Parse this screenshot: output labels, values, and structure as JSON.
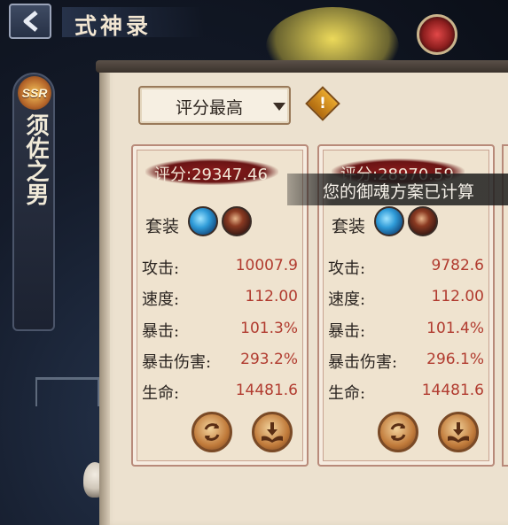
{
  "header": {
    "title": "式神录"
  },
  "shikigami": {
    "rarity": "SSR",
    "name": "须佐之男"
  },
  "sort": {
    "selected": "评分最高"
  },
  "toast": {
    "message": "您的御魂方案已计算"
  },
  "cards": [
    {
      "score": "评分:29347.46",
      "set_label": "套装",
      "stats": [
        {
          "label": "攻击:",
          "value": "10007.9"
        },
        {
          "label": "速度:",
          "value": "112.00"
        },
        {
          "label": "暴击:",
          "value": "101.3%"
        },
        {
          "label": "暴击伤害:",
          "value": "293.2%"
        },
        {
          "label": "生命:",
          "value": "14481.6"
        }
      ]
    },
    {
      "score": "评分:28970.59",
      "set_label": "套装",
      "stats": [
        {
          "label": "攻击:",
          "value": "9782.6"
        },
        {
          "label": "速度:",
          "value": "112.00"
        },
        {
          "label": "暴击:",
          "value": "101.4%"
        },
        {
          "label": "暴击伤害:",
          "value": "296.1%"
        },
        {
          "label": "生命:",
          "value": "14481.6"
        }
      ]
    }
  ],
  "icons": {
    "back": "back-arrow-icon",
    "warning": "warning-icon",
    "soul_1": "blue-soul-icon",
    "soul_2": "dark-soul-icon",
    "replace": "replace-icon",
    "equip": "equip-icon"
  }
}
